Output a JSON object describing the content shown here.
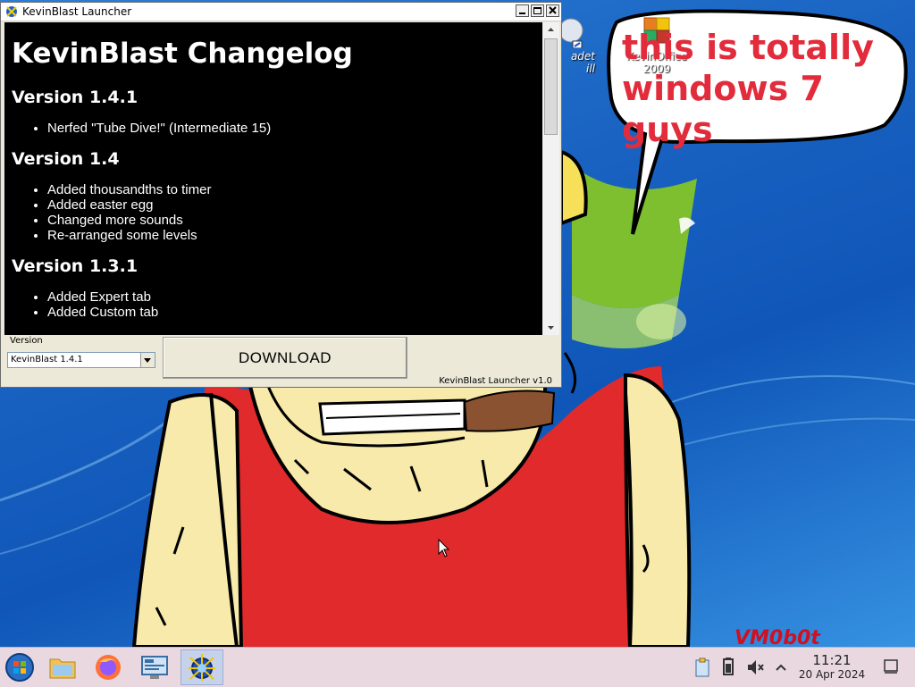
{
  "window": {
    "title": "KevinBlast Launcher"
  },
  "changelog": {
    "heading": "KevinBlast Changelog",
    "sections": [
      {
        "version": "Version 1.4.1",
        "items": [
          "Nerfed \"Tube Dive!\" (Intermediate 15)"
        ]
      },
      {
        "version": "Version 1.4",
        "items": [
          "Added thousandths to timer",
          "Added easter egg",
          "Changed more sounds",
          "Re-arranged some levels"
        ]
      },
      {
        "version": "Version 1.3.1",
        "items": [
          "Added Expert tab",
          "Added Custom tab"
        ]
      }
    ]
  },
  "controls": {
    "version_label": "Version",
    "version_selected": "KevinBlast 1.4.1",
    "download_label": "DOWNLOAD",
    "launcher_version": "KevinBlast Launcher v1.0"
  },
  "desktop": {
    "icons": [
      {
        "label_line1": "KevinOffice",
        "label_line2": "2009",
        "icon": "office-icon"
      },
      {
        "label_line1": "adet",
        "label_line2": "ill",
        "icon": "shortcut-icon"
      }
    ],
    "speech_bubble_text": "this is totally windows 7 guys",
    "watermark": "VM0b0t"
  },
  "taskbar": {
    "items": [
      {
        "name": "start-orb-icon"
      },
      {
        "name": "file-manager-icon"
      },
      {
        "name": "firefox-icon"
      },
      {
        "name": "control-panel-icon"
      },
      {
        "name": "kevinblast-icon",
        "active": true
      }
    ],
    "tray_icons": [
      "clipboard-icon",
      "battery-icon",
      "volume-muted-icon",
      "chevron-up-icon"
    ],
    "time": "11:21",
    "date": "20 Apr 2024"
  },
  "colors": {
    "wallpaper_blue": "#1a63c2",
    "shirt_red": "#e02a2c",
    "skin": "#f7eaaa",
    "speech_text": "#e22c3c",
    "taskbar": "#e9d8e0"
  }
}
